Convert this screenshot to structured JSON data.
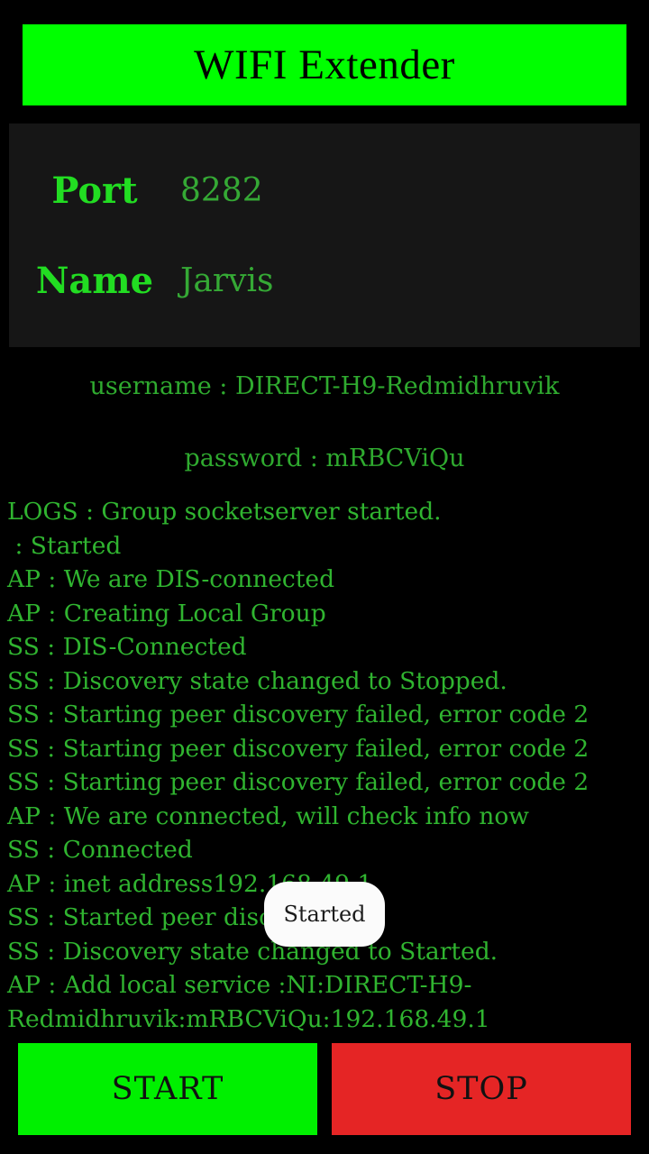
{
  "header": {
    "title": "WIFI Extender",
    "background_color": "#00ff00",
    "text_color": "#000000"
  },
  "info_panel": {
    "port_label": "Port",
    "port_value": "8282",
    "name_label": "Name",
    "name_value": "Jarvis",
    "background_color": "#161616",
    "label_color": "#22dd22",
    "value_color": "#35a935"
  },
  "credentials": {
    "username_line": "username : DIRECT-H9-Redmidhruvik",
    "password_line": "password : mRBCViQu",
    "text_color": "#2faa2f"
  },
  "logs": {
    "text_color": "#30b430",
    "lines": [
      "LOGS : Group socketserver started.",
      " : Started",
      "AP : We are DIS-connected",
      "AP : Creating Local Group",
      "SS : DIS-Connected",
      "SS : Discovery state changed to Stopped.",
      "SS : Starting peer discovery failed, error code 2",
      "SS : Starting peer discovery failed, error code 2",
      "SS : Starting peer discovery failed, error code 2",
      "AP : We are connected, will check info now",
      "SS : Connected",
      "AP : inet address192.168.49.1",
      "SS : Started peer discovery",
      "SS : Discovery state changed to Started.",
      "AP : Add local service :NI:DIRECT-H9-Redmidhruvik:mRBCViQu:192.168.49.1"
    ]
  },
  "toast": {
    "message": "Started",
    "background_color": "#fbfbfb",
    "text_color": "#1c1c1c"
  },
  "buttons": {
    "start_label": "START",
    "start_color": "#00f000",
    "stop_label": "STOP",
    "stop_color": "#e52525"
  }
}
